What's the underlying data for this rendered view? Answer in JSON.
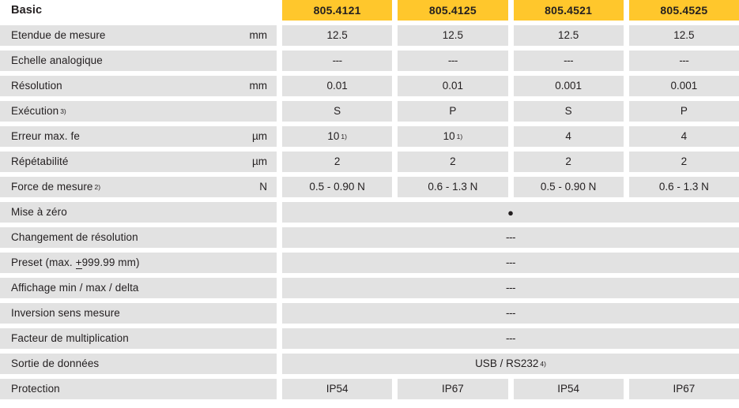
{
  "table": {
    "header": {
      "label": "Basic",
      "columns": [
        "805.4121",
        "805.4125",
        "805.4521",
        "805.4525"
      ],
      "header_bg": "#ffc72c",
      "row_bg": "#e2e2e2"
    },
    "rows": [
      {
        "label": "Etendue de mesure",
        "unit": "mm",
        "merged": false,
        "values": [
          "12.5",
          "12.5",
          "12.5",
          "12.5"
        ]
      },
      {
        "label": "Echelle analogique",
        "unit": "",
        "merged": false,
        "values": [
          "---",
          "---",
          "---",
          "---"
        ]
      },
      {
        "label": "Résolution",
        "unit": "mm",
        "merged": false,
        "values": [
          "0.01",
          "0.01",
          "0.001",
          "0.001"
        ]
      },
      {
        "label": "Exécution",
        "label_sup": "3)",
        "unit": "",
        "merged": false,
        "values": [
          "S",
          "P",
          "S",
          "P"
        ]
      },
      {
        "label": "Erreur max. fe",
        "unit": "µm",
        "merged": false,
        "values": [
          "10",
          "10",
          "4",
          "4"
        ],
        "value_sups": [
          "1)",
          "1)",
          "",
          ""
        ]
      },
      {
        "label": "Répétabilité",
        "unit": "µm",
        "merged": false,
        "values": [
          "2",
          "2",
          "2",
          "2"
        ]
      },
      {
        "label": "Force de mesure",
        "label_sup": "2)",
        "unit": "N",
        "merged": false,
        "values": [
          "0.5 - 0.90 N",
          "0.6 - 1.3 N",
          "0.5 - 0.90 N",
          "0.6 - 1.3 N"
        ]
      },
      {
        "label": "Mise à zéro",
        "unit": "",
        "merged": true,
        "merged_value": "●"
      },
      {
        "label": "Changement de résolution",
        "unit": "",
        "merged": true,
        "merged_value": "---"
      },
      {
        "label": "Preset  (max. ±999.99 mm)",
        "label_prefix": "Preset  (max. ",
        "label_pm": "+",
        "label_suffix": "999.99 mm)",
        "unit": "",
        "merged": true,
        "merged_value": "---"
      },
      {
        "label": "Affichage min / max / delta",
        "unit": "",
        "merged": true,
        "merged_value": "---"
      },
      {
        "label": "Inversion sens mesure",
        "unit": "",
        "merged": true,
        "merged_value": "---"
      },
      {
        "label": "Facteur de multiplication",
        "unit": "",
        "merged": true,
        "merged_value": "---"
      },
      {
        "label": "Sortie de données",
        "unit": "",
        "merged": true,
        "merged_value": "USB / RS232",
        "merged_sup": "4)"
      },
      {
        "label": "Protection",
        "unit": "",
        "merged": false,
        "values": [
          "IP54",
          "IP67",
          "IP54",
          "IP67"
        ]
      }
    ]
  }
}
